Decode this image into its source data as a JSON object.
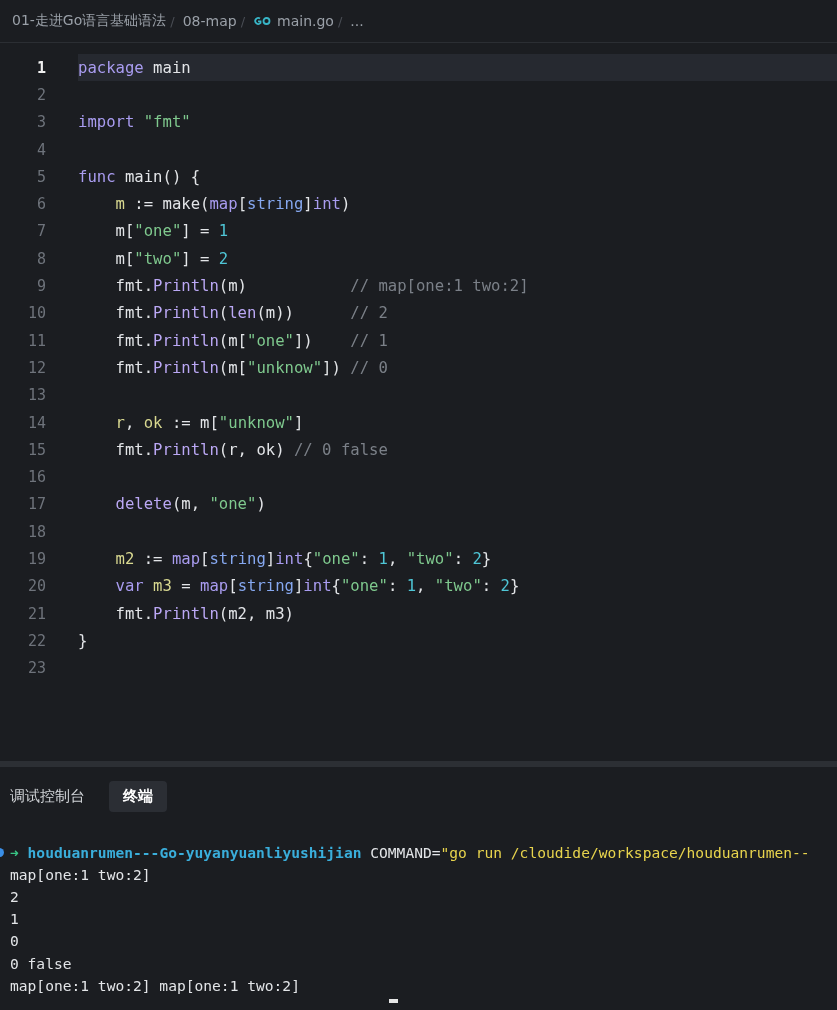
{
  "breadcrumb": [
    {
      "kind": "folder",
      "label": "01-走进Go语言基础语法",
      "separator": "/"
    },
    {
      "kind": "folder",
      "label": "08-map",
      "separator": "/"
    },
    {
      "kind": "go-file",
      "label": "main.go",
      "separator": "/"
    },
    {
      "kind": "more",
      "label": "..."
    }
  ],
  "editor": {
    "lines": [
      {
        "number": "1",
        "active": true,
        "tokens": [
          {
            "kind": "keyword",
            "text": "package"
          },
          {
            "kind": "plain",
            "text": " main"
          }
        ]
      },
      {
        "number": "2",
        "active": false
      },
      {
        "number": "3",
        "active": false,
        "tokens": [
          {
            "kind": "keyword",
            "text": "import"
          },
          {
            "kind": "string",
            "text": " \"fmt\""
          }
        ]
      },
      {
        "number": "4",
        "active": false
      },
      {
        "number": "5",
        "active": false,
        "tokens": [
          {
            "kind": "keyword",
            "text": "func"
          },
          {
            "kind": "plain",
            "text": " main() {"
          }
        ]
      },
      {
        "number": "6",
        "active": false,
        "tokens": [
          {
            "kind": "variable",
            "text": "    m"
          },
          {
            "kind": "plain",
            "text": " := make("
          },
          {
            "kind": "keyword",
            "text": "map"
          },
          {
            "kind": "plain",
            "text": "["
          },
          {
            "kind": "type",
            "text": "string"
          },
          {
            "kind": "plain",
            "text": "]"
          },
          {
            "kind": "keyword",
            "text": "int"
          },
          {
            "kind": "plain",
            "text": ")"
          }
        ]
      },
      {
        "number": "7",
        "active": false,
        "tokens": [
          {
            "kind": "plain",
            "text": "    m["
          },
          {
            "kind": "string",
            "text": "\"one\""
          },
          {
            "kind": "plain",
            "text": "] = "
          },
          {
            "kind": "number",
            "text": "1"
          }
        ]
      },
      {
        "number": "8",
        "active": false,
        "tokens": [
          {
            "kind": "plain",
            "text": "    m["
          },
          {
            "kind": "string",
            "text": "\"two\""
          },
          {
            "kind": "plain",
            "text": "] = "
          },
          {
            "kind": "number",
            "text": "2"
          }
        ]
      },
      {
        "number": "9",
        "active": false,
        "tokens": [
          {
            "kind": "plain",
            "text": "    fmt."
          },
          {
            "kind": "function",
            "text": "Println"
          },
          {
            "kind": "plain",
            "text": "(m)           "
          },
          {
            "kind": "comment",
            "text": "// map[one:1 two:2]"
          }
        ]
      },
      {
        "number": "10",
        "active": false,
        "tokens": [
          {
            "kind": "plain",
            "text": "    fmt."
          },
          {
            "kind": "function",
            "text": "Println"
          },
          {
            "kind": "plain",
            "text": "("
          },
          {
            "kind": "function",
            "text": "len"
          },
          {
            "kind": "plain",
            "text": "(m))      "
          },
          {
            "kind": "comment",
            "text": "// 2"
          }
        ]
      },
      {
        "number": "11",
        "active": false,
        "tokens": [
          {
            "kind": "plain",
            "text": "    fmt."
          },
          {
            "kind": "function",
            "text": "Println"
          },
          {
            "kind": "plain",
            "text": "(m["
          },
          {
            "kind": "string",
            "text": "\"one\""
          },
          {
            "kind": "plain",
            "text": "])    "
          },
          {
            "kind": "comment",
            "text": "// 1"
          }
        ]
      },
      {
        "number": "12",
        "active": false,
        "tokens": [
          {
            "kind": "plain",
            "text": "    fmt."
          },
          {
            "kind": "function",
            "text": "Println"
          },
          {
            "kind": "plain",
            "text": "(m["
          },
          {
            "kind": "string",
            "text": "\"unknow\""
          },
          {
            "kind": "plain",
            "text": "]) "
          },
          {
            "kind": "comment",
            "text": "// 0"
          }
        ]
      },
      {
        "number": "13",
        "active": false
      },
      {
        "number": "14",
        "active": false,
        "tokens": [
          {
            "kind": "variable",
            "text": "    r"
          },
          {
            "kind": "plain",
            "text": ", "
          },
          {
            "kind": "variable",
            "text": "ok"
          },
          {
            "kind": "plain",
            "text": " := m["
          },
          {
            "kind": "string",
            "text": "\"unknow\""
          },
          {
            "kind": "plain",
            "text": "]"
          }
        ]
      },
      {
        "number": "15",
        "active": false,
        "tokens": [
          {
            "kind": "plain",
            "text": "    fmt."
          },
          {
            "kind": "function",
            "text": "Println"
          },
          {
            "kind": "plain",
            "text": "(r, ok) "
          },
          {
            "kind": "comment",
            "text": "// 0 false"
          }
        ]
      },
      {
        "number": "16",
        "active": false
      },
      {
        "number": "17",
        "active": false,
        "tokens": [
          {
            "kind": "function",
            "text": "    delete"
          },
          {
            "kind": "plain",
            "text": "(m, "
          },
          {
            "kind": "string",
            "text": "\"one\""
          },
          {
            "kind": "plain",
            "text": ")"
          }
        ]
      },
      {
        "number": "18",
        "active": false
      },
      {
        "number": "19",
        "active": false,
        "tokens": [
          {
            "kind": "variable",
            "text": "    m2"
          },
          {
            "kind": "plain",
            "text": " := "
          },
          {
            "kind": "keyword",
            "text": "map"
          },
          {
            "kind": "plain",
            "text": "["
          },
          {
            "kind": "type",
            "text": "string"
          },
          {
            "kind": "plain",
            "text": "]"
          },
          {
            "kind": "keyword",
            "text": "int"
          },
          {
            "kind": "plain",
            "text": "{"
          },
          {
            "kind": "string",
            "text": "\"one\""
          },
          {
            "kind": "plain",
            "text": ": "
          },
          {
            "kind": "number",
            "text": "1"
          },
          {
            "kind": "plain",
            "text": ", "
          },
          {
            "kind": "string",
            "text": "\"two\""
          },
          {
            "kind": "plain",
            "text": ": "
          },
          {
            "kind": "number",
            "text": "2"
          },
          {
            "kind": "plain",
            "text": "}"
          }
        ]
      },
      {
        "number": "20",
        "active": false,
        "tokens": [
          {
            "kind": "keyword",
            "text": "    var"
          },
          {
            "kind": "variable",
            "text": " m3"
          },
          {
            "kind": "plain",
            "text": " = "
          },
          {
            "kind": "keyword",
            "text": "map"
          },
          {
            "kind": "plain",
            "text": "["
          },
          {
            "kind": "type",
            "text": "string"
          },
          {
            "kind": "plain",
            "text": "]"
          },
          {
            "kind": "keyword",
            "text": "int"
          },
          {
            "kind": "plain",
            "text": "{"
          },
          {
            "kind": "string",
            "text": "\"one\""
          },
          {
            "kind": "plain",
            "text": ": "
          },
          {
            "kind": "number",
            "text": "1"
          },
          {
            "kind": "plain",
            "text": ", "
          },
          {
            "kind": "string",
            "text": "\"two\""
          },
          {
            "kind": "plain",
            "text": ": "
          },
          {
            "kind": "number",
            "text": "2"
          },
          {
            "kind": "plain",
            "text": "}"
          }
        ]
      },
      {
        "number": "21",
        "active": false,
        "tokens": [
          {
            "kind": "plain",
            "text": "    fmt."
          },
          {
            "kind": "function",
            "text": "Println"
          },
          {
            "kind": "plain",
            "text": "(m2, m3)"
          }
        ]
      },
      {
        "number": "22",
        "active": false,
        "tokens": [
          {
            "kind": "plain",
            "text": "}"
          }
        ]
      },
      {
        "number": "23",
        "active": false
      }
    ]
  },
  "panel": {
    "tabs": [
      {
        "label": "调试控制台",
        "selected": false
      },
      {
        "label": "终端",
        "selected": true
      }
    ],
    "terminal": {
      "lines": [
        {
          "kind": "prompt",
          "tokens": [
            {
              "kind": "arrow",
              "text": "➜"
            },
            {
              "kind": "host",
              "text": " houduanrumen---Go-yuyanyuanliyushijian"
            },
            {
              "kind": "plain",
              "text": " COMMAND="
            },
            {
              "kind": "string",
              "text": "\"go run /cloudide/workspace/houduanrumen--"
            }
          ]
        },
        {
          "kind": "output",
          "tokens": [
            {
              "kind": "plain",
              "text": "map[one:1 two:2]"
            }
          ]
        },
        {
          "kind": "output",
          "tokens": [
            {
              "kind": "plain",
              "text": "2"
            }
          ]
        },
        {
          "kind": "output",
          "tokens": [
            {
              "kind": "plain",
              "text": "1"
            }
          ]
        },
        {
          "kind": "output",
          "tokens": [
            {
              "kind": "plain",
              "text": "0"
            }
          ]
        },
        {
          "kind": "output",
          "tokens": [
            {
              "kind": "plain",
              "text": "0 false"
            }
          ]
        },
        {
          "kind": "output",
          "tokens": [
            {
              "kind": "plain",
              "text": "map[one:1 two:2] map[one:1 two:2]"
            }
          ]
        }
      ],
      "cursor": true
    }
  }
}
